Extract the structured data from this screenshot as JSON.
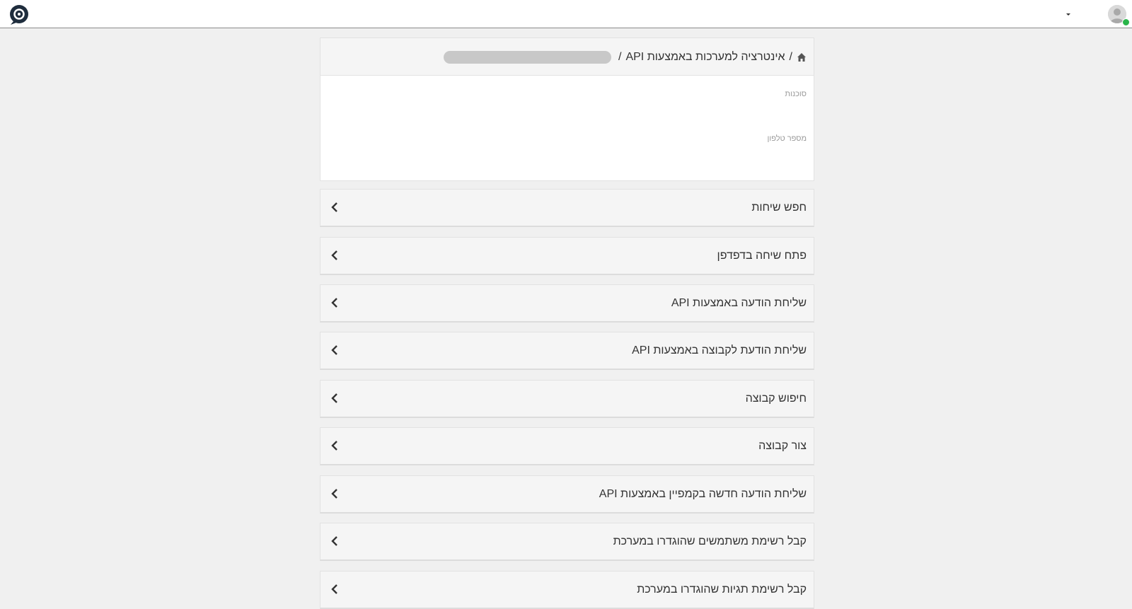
{
  "breadcrumb": {
    "separator": "/",
    "current": "אינטרציה למערכות באמצעות API"
  },
  "form": {
    "agency_label": "סוכנות",
    "phone_label": "מספר טלפון"
  },
  "sections": [
    {
      "label": "חפש שיחות"
    },
    {
      "label": "פתח שיחה בדפדפן"
    },
    {
      "label": "שליחת הודעה באמצעות API"
    },
    {
      "label": "שליחת הודעת לקבוצה באמצעות API"
    },
    {
      "label": "חיפוש קבוצה"
    },
    {
      "label": "צור קבוצה"
    },
    {
      "label": "שליחת הודעה חדשה בקמפיין באמצעות API"
    },
    {
      "label": "קבל רשימת משתמשים שהוגדרו במערכת"
    },
    {
      "label": "קבל רשימת תגיות שהוגדרו במערכת"
    }
  ],
  "colors": {
    "logo": "#1f2d3d",
    "status_online": "#2ab54a"
  }
}
